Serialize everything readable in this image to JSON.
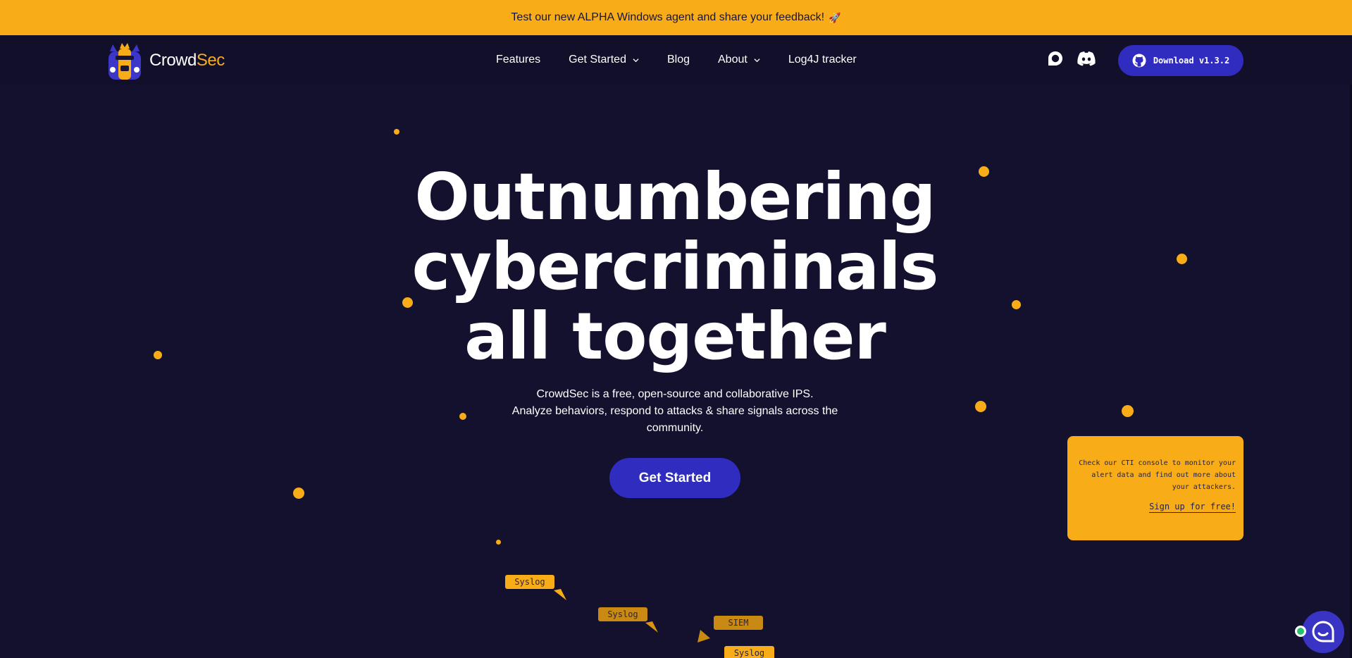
{
  "announcement": {
    "text": "Test our new ALPHA Windows agent and share your feedback!",
    "emoji": "🚀"
  },
  "brand": {
    "name_part1": "Crowd",
    "name_part2": "Sec",
    "accent": "#f8ac17",
    "background": "#14112e",
    "button": "#2f2cbf"
  },
  "nav": {
    "links": [
      {
        "label": "Features",
        "dropdown": false
      },
      {
        "label": "Get Started",
        "dropdown": true
      },
      {
        "label": "Blog",
        "dropdown": false
      },
      {
        "label": "About",
        "dropdown": true
      },
      {
        "label": "Log4J tracker",
        "dropdown": false
      }
    ],
    "icons": [
      "discourse-icon",
      "discord-icon"
    ],
    "download_label": "Download v1.3.2"
  },
  "hero": {
    "title_lines": [
      "Outnumbering",
      "cybercriminals",
      "all together"
    ],
    "subtitle_lines": [
      "CrowdSec is a free, open-source and collaborative IPS.",
      "Analyze behaviors, respond to attacks & share signals across the",
      "community."
    ],
    "cta_label": "Get Started"
  },
  "cti_card": {
    "text_lines": [
      "Check our CTI console to monitor your",
      "alert data and find out more about",
      "your attackers."
    ],
    "link_label": "Sign up for free!"
  },
  "flow_tags": [
    "Syslog",
    "Syslog",
    "SIEM",
    "Syslog"
  ]
}
